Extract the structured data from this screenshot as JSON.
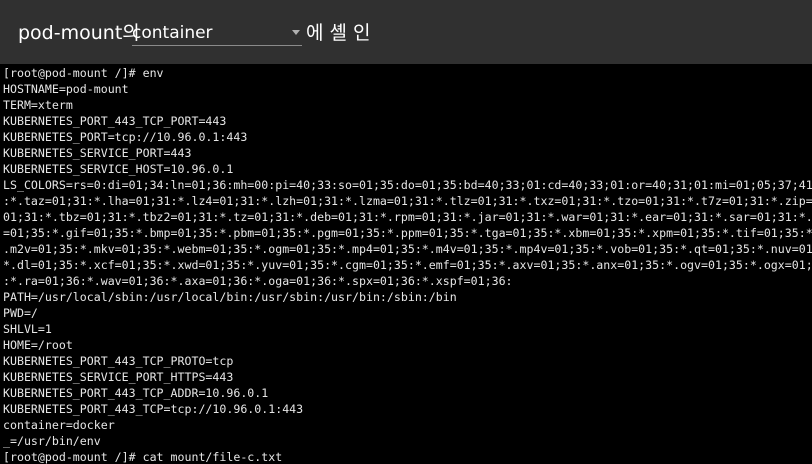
{
  "header": {
    "pod_name": "pod-mount의",
    "container_select": {
      "value": "container"
    },
    "shell_title": "에 셸 인"
  },
  "terminal": {
    "lines": [
      "[root@pod-mount /]# env",
      "HOSTNAME=pod-mount",
      "TERM=xterm",
      "KUBERNETES_PORT_443_TCP_PORT=443",
      "KUBERNETES_PORT=tcp://10.96.0.1:443",
      "KUBERNETES_SERVICE_PORT=443",
      "KUBERNETES_SERVICE_HOST=10.96.0.1",
      "LS_COLORS=rs=0:di=01;34:ln=01;36:mh=00:pi=40;33:so=01;35:do=01;35:bd=40;33;01:cd=40;33;01:or=40;31;01:mi=01;05;37;41",
      ":*.taz=01;31:*.lha=01;31:*.lz4=01;31:*.lzh=01;31:*.lzma=01;31:*.tlz=01;31:*.txz=01;31:*.tzo=01;31:*.t7z=01;31:*.zip=",
      "01;31:*.tbz=01;31:*.tbz2=01;31:*.tz=01;31:*.deb=01;31:*.rpm=01;31:*.jar=01;31:*.war=01;31:*.ear=01;31:*.sar=01;31:*.",
      "=01;35:*.gif=01;35:*.bmp=01;35:*.pbm=01;35:*.pgm=01;35:*.ppm=01;35:*.tga=01;35:*.xbm=01;35:*.xpm=01;35:*.tif=01;35:*",
      ".m2v=01;35:*.mkv=01;35:*.webm=01;35:*.ogm=01;35:*.mp4=01;35:*.m4v=01;35:*.mp4v=01;35:*.vob=01;35:*.qt=01;35:*.nuv=01",
      "*.dl=01;35:*.xcf=01;35:*.xwd=01;35:*.yuv=01;35:*.cgm=01;35:*.emf=01;35:*.axv=01;35:*.anx=01;35:*.ogv=01;35:*.ogx=01;",
      ":*.ra=01;36:*.wav=01;36:*.axa=01;36:*.oga=01;36:*.spx=01;36:*.xspf=01;36:",
      "PATH=/usr/local/sbin:/usr/local/bin:/usr/sbin:/usr/bin:/sbin:/bin",
      "PWD=/",
      "SHLVL=1",
      "HOME=/root",
      "KUBERNETES_PORT_443_TCP_PROTO=tcp",
      "KUBERNETES_SERVICE_PORT_HTTPS=443",
      "KUBERNETES_PORT_443_TCP_ADDR=10.96.0.1",
      "KUBERNETES_PORT_443_TCP=tcp://10.96.0.1:443",
      "container=docker",
      "_=/usr/bin/env",
      "[root@pod-mount /]# cat mount/file-c.txt"
    ]
  }
}
